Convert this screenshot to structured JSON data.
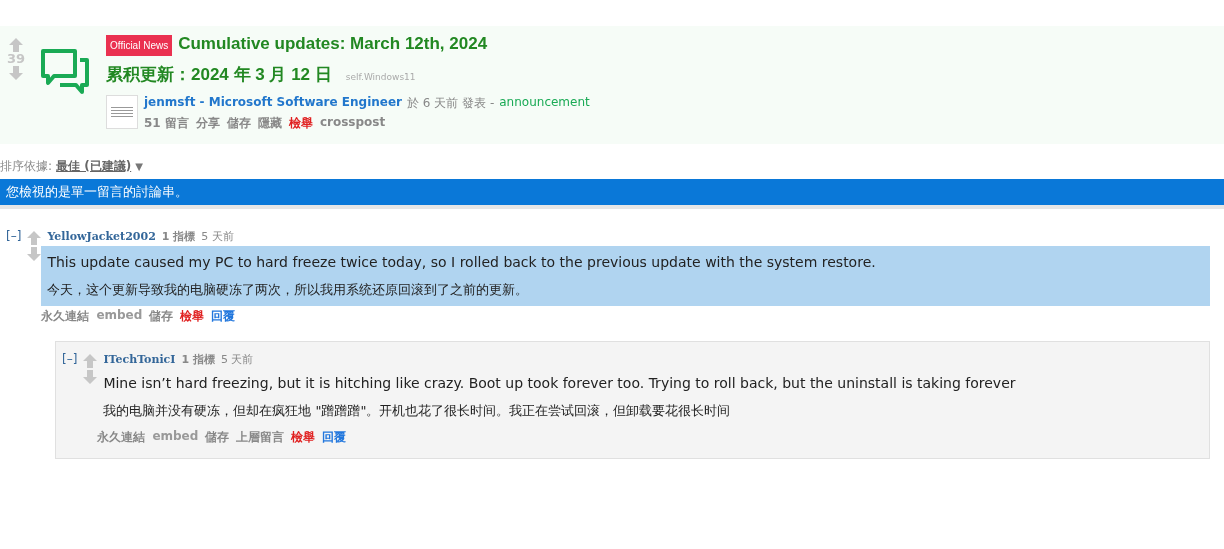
{
  "post": {
    "score": "39",
    "flair": "Official News",
    "title": "Cumulative updates: March 12th, 2024",
    "subtitle": "累积更新：2024 年 3 月 12 日",
    "domain": "self.Windows11",
    "author": "jenmsft - Microsoft Software Engineer",
    "tagline": "於 6 天前 發表 -",
    "link_flair": "announcement",
    "actions": [
      {
        "label": "51 留言",
        "kind": "normal"
      },
      {
        "label": "分享",
        "kind": "normal"
      },
      {
        "label": "儲存",
        "kind": "normal"
      },
      {
        "label": "隱藏",
        "kind": "normal"
      },
      {
        "label": "檢舉",
        "kind": "report"
      },
      {
        "label": "crosspost",
        "kind": "normal"
      }
    ]
  },
  "sort": {
    "label": "排序依據:",
    "value": "最佳 (已建議)",
    "caret": "▼"
  },
  "banner": "您檢視的是單一留言的討論串。",
  "comments": [
    {
      "toggle": "[–]",
      "author": "YellowJacket2002",
      "points": "1 指標",
      "time": "5 天前",
      "highlighted": true,
      "paragraphs": [
        "This update caused my PC to hard freeze twice today, so I rolled back to the previous update with the system restore.",
        "今天，这个更新导致我的电脑硬冻了两次，所以我用系统还原回滚到了之前的更新。"
      ],
      "actions": [
        {
          "label": "永久連結",
          "kind": "normal"
        },
        {
          "label": "embed",
          "kind": "bold"
        },
        {
          "label": "儲存",
          "kind": "normal"
        },
        {
          "label": "檢舉",
          "kind": "report"
        },
        {
          "label": "回覆",
          "kind": "reply"
        }
      ],
      "children": [
        {
          "toggle": "[–]",
          "author": "ITechTonicI",
          "points": "1 指標",
          "time": "5 天前",
          "highlighted": false,
          "paragraphs": [
            "Mine isn’t hard freezing, but it is hitching like crazy. Boot up took forever too. Trying to roll back, but the uninstall is taking forever",
            "我的电脑并没有硬冻，但却在疯狂地 \"蹭蹭蹭\"。开机也花了很长时间。我正在尝试回滚，但卸载要花很长时间"
          ],
          "actions": [
            {
              "label": "永久連結",
              "kind": "normal"
            },
            {
              "label": "embed",
              "kind": "bold"
            },
            {
              "label": "儲存",
              "kind": "normal"
            },
            {
              "label": "上層留言",
              "kind": "normal"
            },
            {
              "label": "檢舉",
              "kind": "report"
            },
            {
              "label": "回覆",
              "kind": "reply"
            }
          ]
        }
      ]
    }
  ]
}
